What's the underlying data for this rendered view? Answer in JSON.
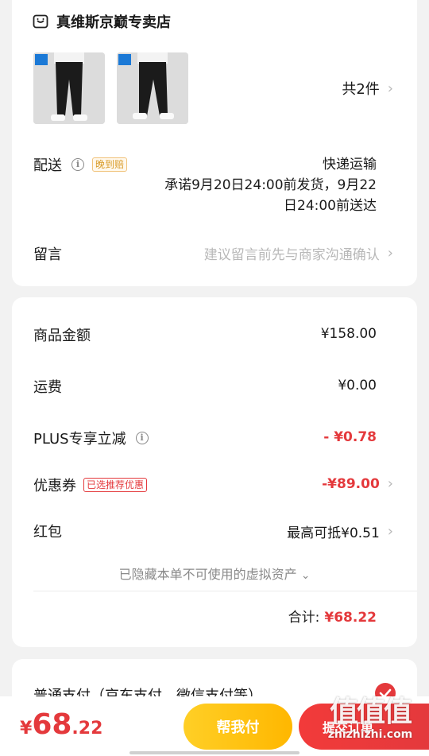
{
  "store": {
    "name": "真维斯京巅专卖店",
    "icon": "store-icon",
    "item_count": "共2件"
  },
  "delivery": {
    "label": "配送",
    "tag": "晚到赔",
    "method": "快递运输",
    "promise_line1": "承诺9月20日24:00前发货，9月22",
    "promise_line2": "日24:00前送达"
  },
  "note": {
    "label": "留言",
    "placeholder": "建议留言前先与商家沟通确认"
  },
  "costs": {
    "goods_label": "商品金额",
    "goods_value": "¥158.00",
    "shipping_label": "运费",
    "shipping_value": "¥0.00",
    "plus_label": "PLUS专享立减",
    "plus_value": "- ¥0.78",
    "coupon_label": "优惠券",
    "coupon_tag": "已选推荐优惠",
    "coupon_value": "-¥89.00",
    "redpack_label": "红包",
    "redpack_value": "最高可抵¥0.51",
    "hidden_assets": "已隐藏本单不可使用的虚拟资产",
    "total_label": "合计:",
    "total_value": "¥68.22"
  },
  "payment": {
    "method_label": "普通支付（京东支付、微信支付等）"
  },
  "bottom": {
    "price_symbol": "¥",
    "price_int": "68",
    "price_dec": ".22",
    "help_pay": "帮我付",
    "submit": "提交订单",
    "watermark_big": "值值值",
    "watermark_url": "zhizhizhi.com"
  },
  "colors": {
    "accent_red": "#e4393c",
    "help_yellow": "#ffc300"
  }
}
